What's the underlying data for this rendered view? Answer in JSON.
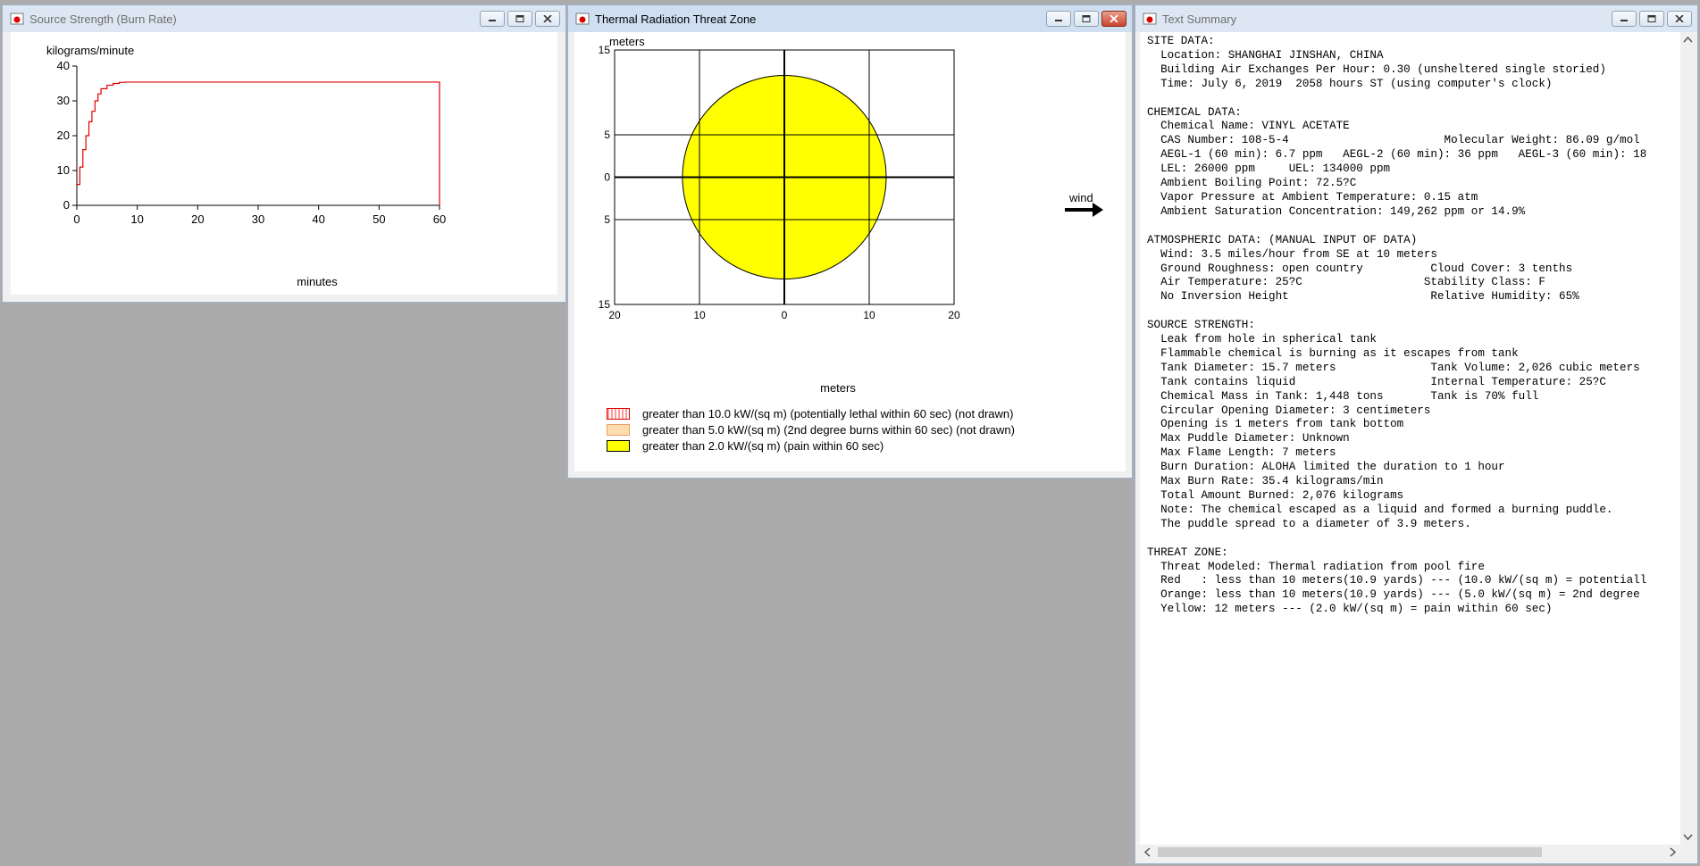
{
  "colors": {
    "desktop": "#ababab",
    "burn_line": "#e00000",
    "zone_yellow": "#ffff00",
    "zone_orange": "#ffd8a8",
    "zone_red_pattern": "#ff9090"
  },
  "burn_window": {
    "title": "Source Strength (Burn Rate)",
    "icon": "aloha-app-icon"
  },
  "threat_window": {
    "title": "Thermal Radiation Threat Zone",
    "icon": "aloha-app-icon",
    "wind_label": "wind",
    "legend": [
      {
        "label": "greater than 10.0 kW/(sq m) (potentially lethal within 60 sec) (not drawn)",
        "swatch": "red-dotted"
      },
      {
        "label": "greater than 5.0 kW/(sq m) (2nd degree burns within 60 sec) (not drawn)",
        "swatch": "orange"
      },
      {
        "label": "greater than 2.0 kW/(sq m) (pain within 60 sec)",
        "swatch": "yellow"
      }
    ]
  },
  "summary_window": {
    "title": "Text Summary",
    "icon": "aloha-app-icon",
    "lines": [
      "SITE DATA:",
      "  Location: SHANGHAI JINSHAN, CHINA",
      "  Building Air Exchanges Per Hour: 0.30 (unsheltered single storied)",
      "  Time: July 6, 2019  2058 hours ST (using computer's clock)",
      "",
      "CHEMICAL DATA:",
      "  Chemical Name: VINYL ACETATE",
      "  CAS Number: 108-5-4                       Molecular Weight: 86.09 g/mol",
      "  AEGL-1 (60 min): 6.7 ppm   AEGL-2 (60 min): 36 ppm   AEGL-3 (60 min): 18",
      "  LEL: 26000 ppm     UEL: 134000 ppm",
      "  Ambient Boiling Point: 72.5?C",
      "  Vapor Pressure at Ambient Temperature: 0.15 atm",
      "  Ambient Saturation Concentration: 149,262 ppm or 14.9%",
      "",
      "ATMOSPHERIC DATA: (MANUAL INPUT OF DATA)",
      "  Wind: 3.5 miles/hour from SE at 10 meters",
      "  Ground Roughness: open country          Cloud Cover: 3 tenths",
      "  Air Temperature: 25?C                  Stability Class: F",
      "  No Inversion Height                     Relative Humidity: 65%",
      "",
      "SOURCE STRENGTH:",
      "  Leak from hole in spherical tank",
      "  Flammable chemical is burning as it escapes from tank",
      "  Tank Diameter: 15.7 meters              Tank Volume: 2,026 cubic meters",
      "  Tank contains liquid                    Internal Temperature: 25?C",
      "  Chemical Mass in Tank: 1,448 tons       Tank is 70% full",
      "  Circular Opening Diameter: 3 centimeters",
      "  Opening is 1 meters from tank bottom",
      "  Max Puddle Diameter: Unknown",
      "  Max Flame Length: 7 meters",
      "  Burn Duration: ALOHA limited the duration to 1 hour",
      "  Max Burn Rate: 35.4 kilograms/min",
      "  Total Amount Burned: 2,076 kilograms",
      "  Note: The chemical escaped as a liquid and formed a burning puddle.",
      "  The puddle spread to a diameter of 3.9 meters.",
      "",
      "THREAT ZONE:",
      "  Threat Modeled: Thermal radiation from pool fire",
      "  Red   : less than 10 meters(10.9 yards) --- (10.0 kW/(sq m) = potentiall",
      "  Orange: less than 10 meters(10.9 yards) --- (5.0 kW/(sq m) = 2nd degree",
      "  Yellow: 12 meters --- (2.0 kW/(sq m) = pain within 60 sec)"
    ]
  },
  "chart_data": [
    {
      "type": "line",
      "title": "",
      "ylabel": "kilograms/minute",
      "xlabel": "minutes",
      "xlim": [
        0,
        60
      ],
      "ylim": [
        0,
        40
      ],
      "xticks": [
        "0",
        "10",
        "20",
        "30",
        "40",
        "50",
        "60"
      ],
      "yticks": [
        "0",
        "10",
        "20",
        "30",
        "40"
      ],
      "step": true,
      "series": [
        {
          "x": [
            0,
            0.5,
            1,
            1.5,
            2,
            2.5,
            3,
            3.5,
            4,
            5,
            6,
            7,
            8,
            9,
            60,
            60
          ],
          "y": [
            6,
            11,
            16,
            20,
            24,
            27,
            30,
            32,
            33.5,
            34.5,
            35,
            35.3,
            35.4,
            35.4,
            35.4,
            0
          ]
        }
      ]
    },
    {
      "type": "scatter",
      "title": "",
      "xlabel": "meters",
      "ylabel": "meters",
      "xlim": [
        -20,
        20
      ],
      "ylim": [
        -15,
        15
      ],
      "xticks": [
        "20",
        "10",
        "0",
        "10",
        "20"
      ],
      "yticks": [
        "15",
        "5",
        "0",
        "5",
        "15"
      ],
      "zone_radius_m": 12,
      "zone_label": "greater than 2.0 kW/(sq m) (pain within 60 sec)"
    }
  ]
}
